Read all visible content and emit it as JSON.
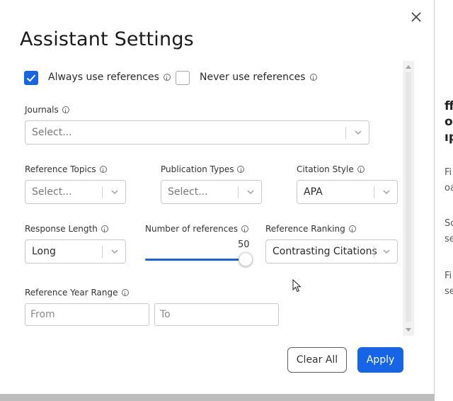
{
  "modal": {
    "title": "Assistant Settings",
    "close_icon": "close-icon"
  },
  "options": {
    "always_use_references": {
      "label": "Always use references",
      "checked": true
    },
    "never_use_references": {
      "label": "Never use references",
      "checked": false
    }
  },
  "fields": {
    "journals": {
      "label": "Journals",
      "placeholder": "Select..."
    },
    "reference_topics": {
      "label": "Reference Topics",
      "placeholder": "Select..."
    },
    "publication_types": {
      "label": "Publication Types",
      "placeholder": "Select..."
    },
    "citation_style": {
      "label": "Citation Style",
      "value": "APA"
    },
    "response_length": {
      "label": "Response Length",
      "value": "Long"
    },
    "number_of_references": {
      "label": "Number of references",
      "value": "50"
    },
    "reference_ranking": {
      "label": "Reference Ranking",
      "value": "Contrasting Citations"
    },
    "reference_year_range": {
      "label": "Reference Year Range",
      "from_placeholder": "From",
      "to_placeholder": "To"
    }
  },
  "buttons": {
    "clear_all": "Clear All",
    "apply": "Apply"
  },
  "background_page": {
    "fragments": [
      "ff",
      "o",
      "ıp",
      "Fi",
      "oa",
      "Sc",
      "se",
      "Fi",
      "se"
    ]
  },
  "colors": {
    "accent": "#1565e6",
    "backdrop": "#5a5a5a"
  }
}
